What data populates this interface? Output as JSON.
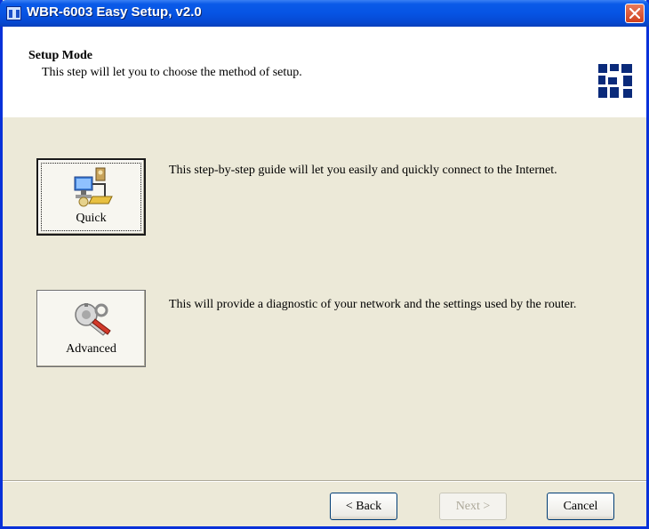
{
  "window": {
    "title": "WBR-6003 Easy Setup, v2.0"
  },
  "header": {
    "title": "Setup Mode",
    "subtitle": "This step will let you to choose the method of setup."
  },
  "options": [
    {
      "label": "Quick",
      "description": "This step-by-step guide will let you easily and quickly connect to the Internet.",
      "icon": "network-wizard-icon",
      "is_default": true
    },
    {
      "label": "Advanced",
      "description": "This will provide a diagnostic of your network and the settings used by the router.",
      "icon": "wrench-settings-icon",
      "is_default": false
    }
  ],
  "footer": {
    "back_label": "< Back",
    "next_label": "Next >",
    "next_enabled": false,
    "cancel_label": "Cancel"
  },
  "colors": {
    "titlebar": "#0654e4",
    "dialog_bg": "#ece9d8",
    "logo": "#0a2a7a",
    "close_button": "#d0411e"
  }
}
